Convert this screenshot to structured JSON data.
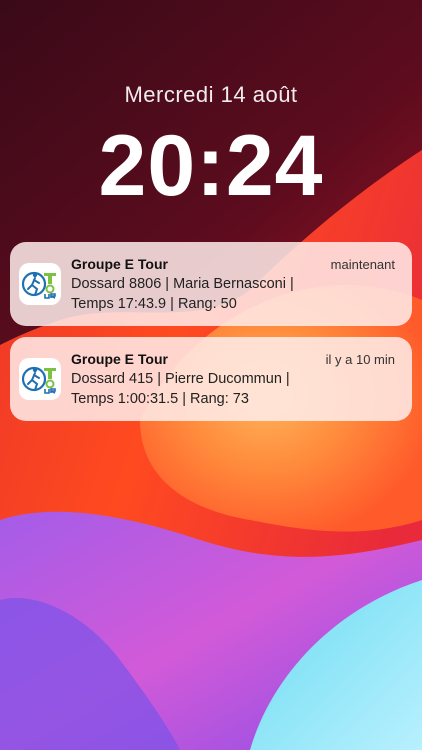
{
  "lockscreen": {
    "date": "Mercredi 14 août",
    "time": "20:24"
  },
  "notifications": [
    {
      "app": "Groupe E Tour",
      "timestamp": "maintenant",
      "line1": "Dossard 8806 | Maria Bernasconi |",
      "line2": "Temps 17:43.9 | Rang: 50",
      "icon": "groupe-e-tour-app-icon"
    },
    {
      "app": "Groupe E Tour",
      "timestamp": "il y a 10 min",
      "line1": "Dossard 415 | Pierre Ducommun |",
      "line2": "Temps 1:00:31.5 | Rang: 73",
      "icon": "groupe-e-tour-app-icon"
    }
  ],
  "colors": {
    "notification_bg": "#ffece9",
    "logo_blue": "#1f6fb3",
    "logo_green": "#7cc242"
  }
}
